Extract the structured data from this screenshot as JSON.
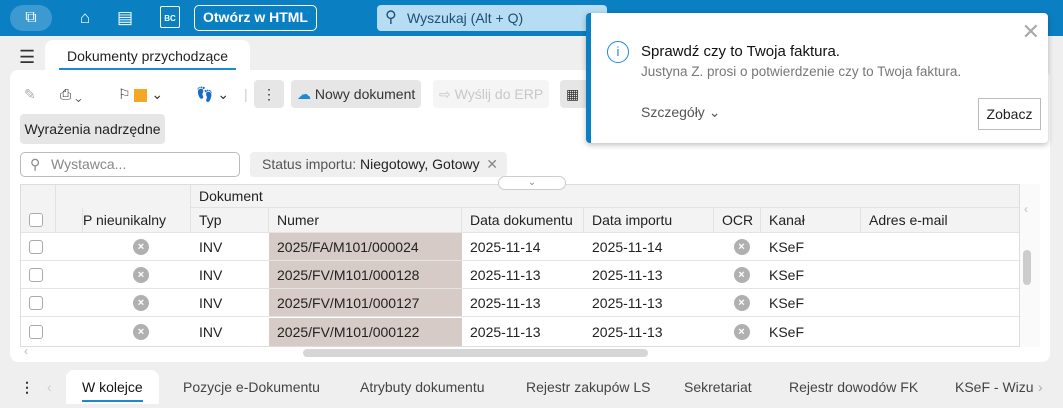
{
  "topbar": {
    "open_html": "Otwórz w HTML",
    "search_placeholder": "Wyszukaj (Alt + Q)",
    "bc_label": "BC"
  },
  "tab": {
    "title": "Dokumenty przychodzące"
  },
  "toolbar": {
    "new_doc": "Nowy dokument",
    "send_erp": "Wyślij do ERP",
    "parent_expr": "Wyrażenia nadrzędne",
    "flag_color": "#f5a623"
  },
  "filter": {
    "placeholder": "Wystawca...",
    "chip_label": "Status importu:",
    "chip_value": "Niegotowy, Gotowy"
  },
  "table": {
    "group_header": "Dokument",
    "columns": [
      "P nieunikalny",
      "Typ",
      "Numer",
      "Data dokumentu",
      "Data importu",
      "OCR",
      "Kanał",
      "Adres e-mail"
    ],
    "rows": [
      {
        "typ": "INV",
        "numer": "2025/FA/M101/000024",
        "data_dok": "2025-11-14",
        "data_imp": "2025-11-14",
        "kanal": "KSeF",
        "email": ""
      },
      {
        "typ": "INV",
        "numer": "2025/FV/M101/000128",
        "data_dok": "2025-11-13",
        "data_imp": "2025-11-13",
        "kanal": "KSeF",
        "email": ""
      },
      {
        "typ": "INV",
        "numer": "2025/FV/M101/000127",
        "data_dok": "2025-11-13",
        "data_imp": "2025-11-13",
        "kanal": "KSeF",
        "email": ""
      },
      {
        "typ": "INV",
        "numer": "2025/FV/M101/000122",
        "data_dok": "2025-11-13",
        "data_imp": "2025-11-13",
        "kanal": "KSeF",
        "email": ""
      }
    ]
  },
  "bottom_tabs": [
    "W kolejce",
    "Pozycje e-Dokumentu",
    "Atrybuty dokumentu",
    "Rejestr zakupów LS",
    "Sekretariat",
    "Rejestr dowodów FK",
    "KSeF - Wizua"
  ],
  "notification": {
    "title": "Sprawdź czy to Twoja faktura.",
    "message": "Justyna Z. prosi o potwierdzenie czy to Twoja faktura.",
    "details": "Szczegóły",
    "action": "Zobacz",
    "badge": "1"
  }
}
